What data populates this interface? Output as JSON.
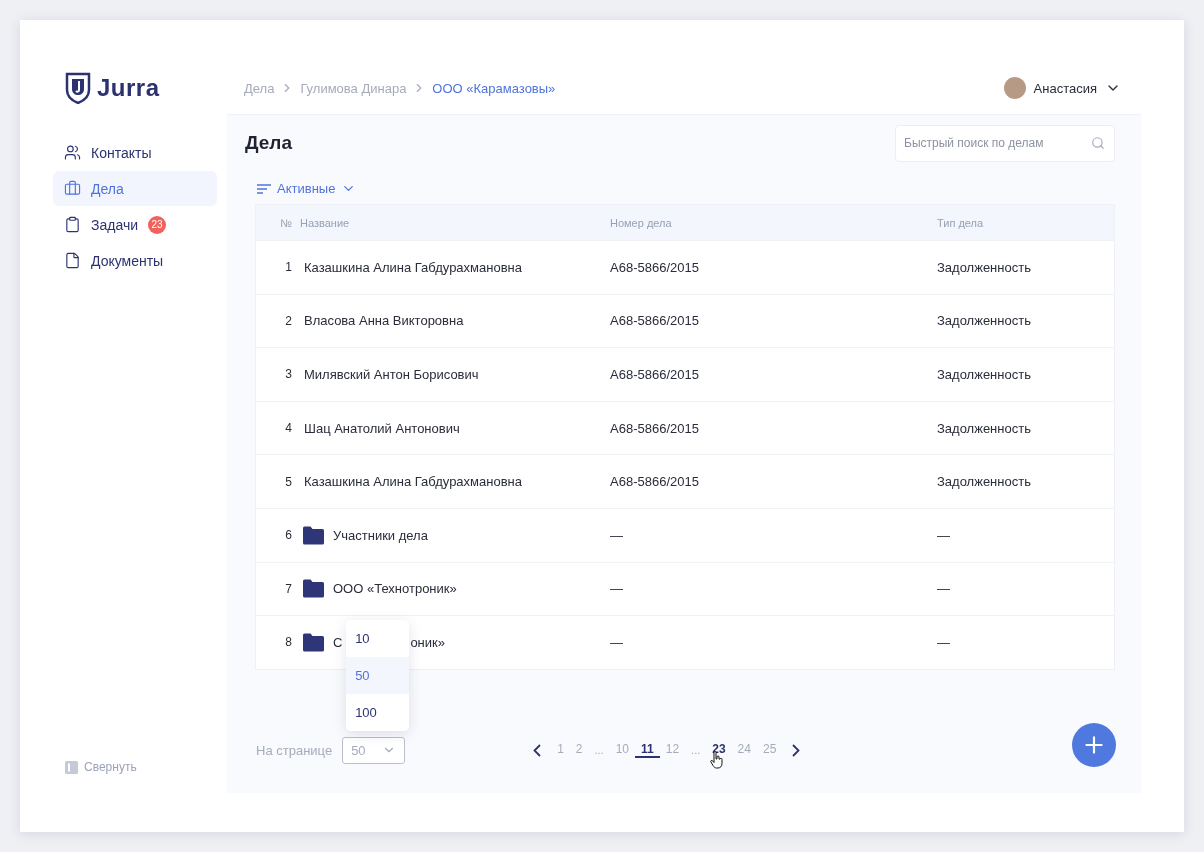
{
  "logo": {
    "text": "Jurra"
  },
  "sidebar": {
    "items": [
      {
        "label": "Контакты",
        "selected": false
      },
      {
        "label": "Дела",
        "selected": true
      },
      {
        "label": "Задачи",
        "selected": false,
        "badge": "23"
      },
      {
        "label": "Документы",
        "selected": false
      }
    ],
    "collapse": "Свернуть"
  },
  "breadcrumbs": [
    {
      "label": "Дела",
      "current": false
    },
    {
      "label": "Гулимова Динара",
      "current": false
    },
    {
      "label": "ООО «Карамазовы»",
      "current": true
    }
  ],
  "user": {
    "name": "Анастасия"
  },
  "title": "Дела",
  "search": {
    "placeholder": "Быстрый поиск по делам"
  },
  "filter": {
    "label": "Активные"
  },
  "table": {
    "columns": [
      "№",
      "Название",
      "Номер дела",
      "Тип дела"
    ],
    "rows": [
      {
        "kind": "case",
        "num": "1",
        "name": "Казашкина Алина Габдурахмановна",
        "case_no": "А68-5866/2015",
        "type": "Задолженность"
      },
      {
        "kind": "case",
        "num": "2",
        "name": "Власова Анна Викторовна",
        "case_no": "А68-5866/2015",
        "type": "Задолженность"
      },
      {
        "kind": "case",
        "num": "3",
        "name": "Милявский Антон Борисович",
        "case_no": "А68-5866/2015",
        "type": "Задолженность"
      },
      {
        "kind": "case",
        "num": "4",
        "name": "Шац Анатолий Антонович",
        "case_no": "А68-5866/2015",
        "type": "Задолженность"
      },
      {
        "kind": "case",
        "num": "5",
        "name": "Казашкина Алина Габдурахмановна",
        "case_no": "А68-5866/2015",
        "type": "Задолженность"
      },
      {
        "kind": "folder",
        "num": "6",
        "name": "Участники дела",
        "case_no": "—",
        "type": "—"
      },
      {
        "kind": "folder",
        "num": "7",
        "name": "ООО «Технотроник»",
        "case_no": "—",
        "type": "—"
      },
      {
        "kind": "folder",
        "num": "8",
        "name": "С",
        "name_tail": "оник»",
        "case_no": "—",
        "type": "—"
      }
    ]
  },
  "per_page": {
    "label": "На странице",
    "value": "50",
    "options": [
      {
        "label": "10",
        "selected": false
      },
      {
        "label": "50",
        "selected": true
      },
      {
        "label": "100",
        "selected": false
      }
    ]
  },
  "pagination": [
    {
      "kind": "page",
      "label": "1",
      "selected": false,
      "hovered": false
    },
    {
      "kind": "page",
      "label": "2",
      "selected": false,
      "hovered": false
    },
    {
      "kind": "ellipsis",
      "label": "..."
    },
    {
      "kind": "page",
      "label": "10",
      "selected": false,
      "hovered": false
    },
    {
      "kind": "page",
      "label": "11",
      "selected": true,
      "hovered": false
    },
    {
      "kind": "page",
      "label": "12",
      "selected": false,
      "hovered": false
    },
    {
      "kind": "ellipsis",
      "label": "..."
    },
    {
      "kind": "page",
      "label": "23",
      "selected": false,
      "hovered": true
    },
    {
      "kind": "page",
      "label": "24",
      "selected": false,
      "hovered": false
    },
    {
      "kind": "page",
      "label": "25",
      "selected": false,
      "hovered": false
    }
  ]
}
